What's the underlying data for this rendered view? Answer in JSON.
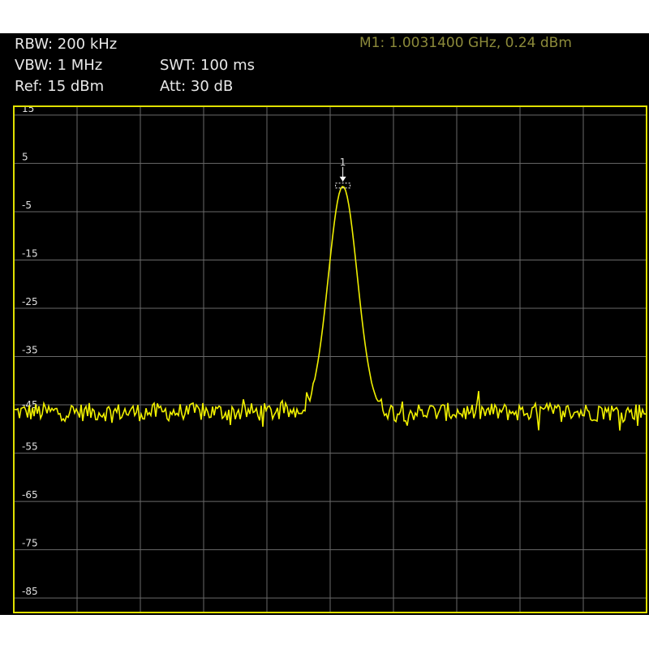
{
  "header": {
    "rbw": "RBW: 200 kHz",
    "vbw": "VBW: 1 MHz",
    "swt": "SWT: 100 ms",
    "ref": "Ref: 15 dBm",
    "att": "Att: 30 dB",
    "marker_readout": "M1: 1.0031400 GHz, 0.24 dBm"
  },
  "marker": {
    "label": "1",
    "x_fraction": 0.52,
    "level_dbm": 0.24
  },
  "colors": {
    "background": "#000000",
    "grid": "#6a6a6a",
    "trace": "#f0f000",
    "border": "#e0e000",
    "text": "#e8e8e8",
    "marker_text": "#8c8a3a"
  },
  "display_line_label": "-45",
  "chart_data": {
    "type": "line",
    "ylim": [
      -88,
      17
    ],
    "y_ticks": [
      "15",
      "5",
      "-5",
      "-15",
      "-25",
      "-35",
      "-45",
      "-55",
      "-65",
      "-75",
      "-85"
    ],
    "x_divisions": 10,
    "grid": true,
    "noise_floor_dbm": -46.5,
    "peak": {
      "x_fraction": 0.52,
      "level_dbm": 0.24,
      "width_fraction": 0.05
    }
  }
}
